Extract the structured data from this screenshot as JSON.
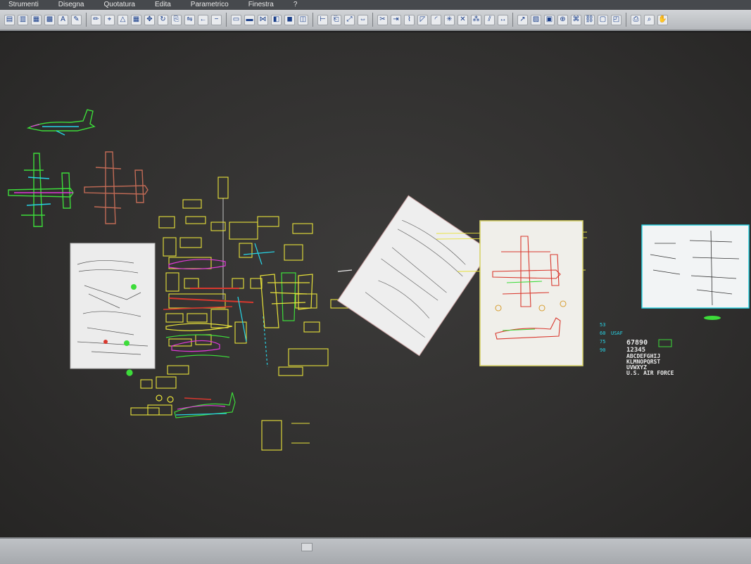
{
  "menu": {
    "items": [
      "Strumenti",
      "Disegna",
      "Quotatura",
      "Edita",
      "Parametrico",
      "Finestra",
      "?"
    ]
  },
  "toolbar": {
    "buttons": [
      "layers-icon",
      "layer-state-icon",
      "layer-props-icon",
      "table-icon",
      "text-icon",
      "paint-icon",
      "pen-icon",
      "match-props-icon",
      "triangle-icon",
      "grid-icon",
      "move-icon",
      "rotate-icon",
      "copy-icon",
      "mirror-icon",
      "arrow-left-icon",
      "minus-icon",
      "rectangle-icon",
      "rectangle-filled-icon",
      "join-icon",
      "region-icon",
      "solid-icon",
      "box-icon",
      "measure-icon",
      "clipboard-icon",
      "scale-icon",
      "stretch-icon",
      "trim-icon",
      "extend-icon",
      "break-icon",
      "chamfer-icon",
      "fillet-icon",
      "explode-icon",
      "erase-icon",
      "array-icon",
      "offset-icon",
      "dimension-icon",
      "leader-icon",
      "hatch-icon",
      "block-icon",
      "insert-icon",
      "attribute-icon",
      "xref-icon",
      "image-icon",
      "layout-icon",
      "plot-icon",
      "zoom-icon",
      "pan-icon"
    ]
  },
  "colors": {
    "canvas": "#312f2e",
    "yellow": "#e8e23a",
    "green": "#3ddc3a",
    "cyan": "#27d4e6",
    "red": "#d9382e",
    "magenta": "#e23ad9",
    "salmon": "#c06a55",
    "white": "#e8e8e8"
  },
  "drawing_text": {
    "serial": "67890",
    "digits": "12345",
    "alpha1": "ABCDEFGHIJ",
    "alpha2": "KLMNOPQRST",
    "alpha3": "UVWXYZ",
    "air_force": "U.S. AIR FORCE",
    "tag": "USAF",
    "num1": "53",
    "num2": "60",
    "num3": "75",
    "num4": "90"
  }
}
